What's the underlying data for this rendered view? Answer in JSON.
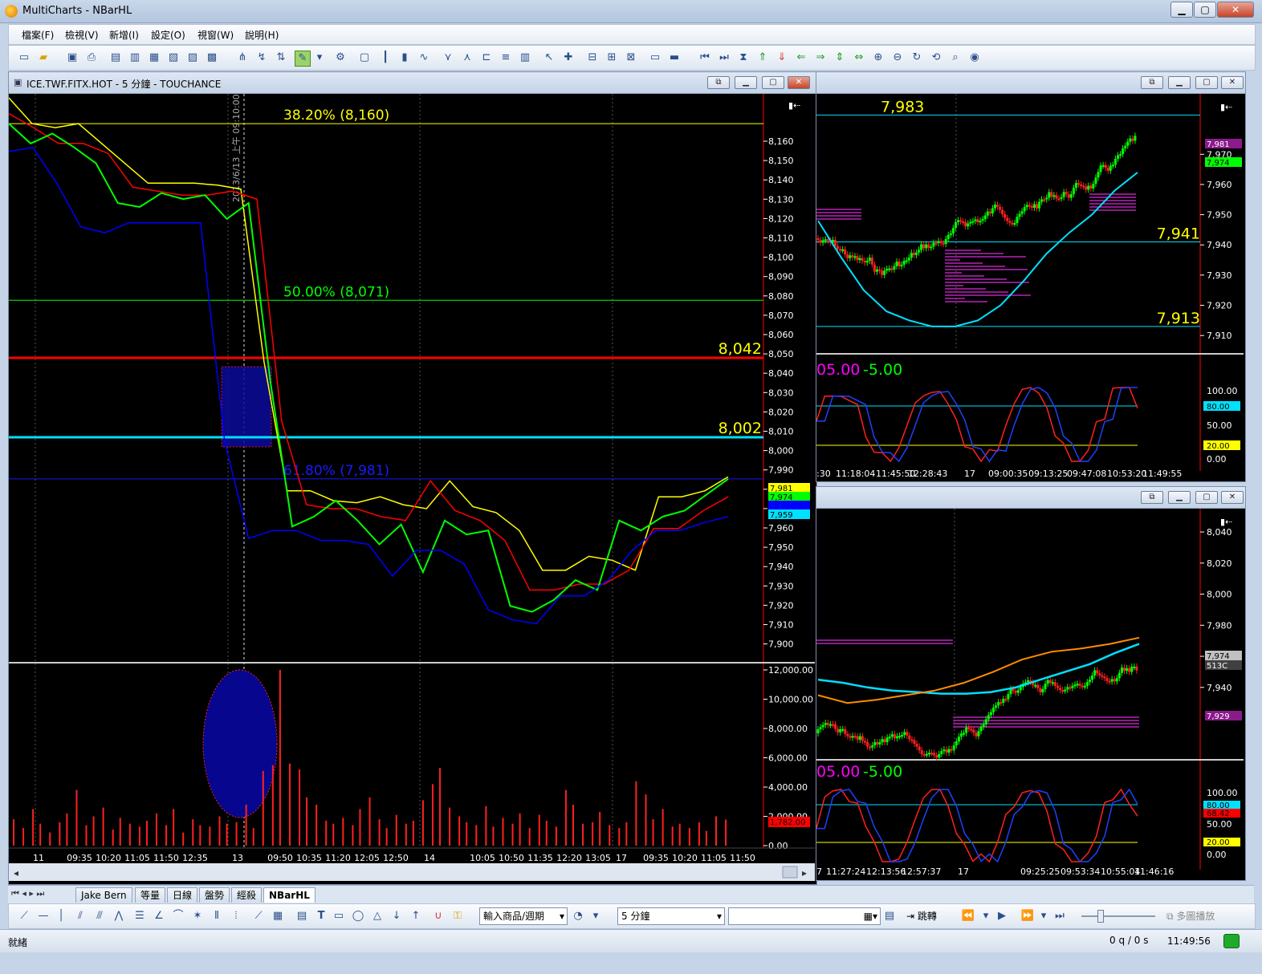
{
  "window": {
    "title": "MultiCharts - NBarHL",
    "min": "▁",
    "max": "▢",
    "close": "✕"
  },
  "menu": [
    "檔案(F)",
    "檢視(V)",
    "新增(I)",
    "設定(O)",
    "視窗(W)",
    "說明(H)"
  ],
  "colors": {
    "bg": "#000000",
    "red": "#ff0000",
    "cyan": "#00e0ff",
    "yellow": "#ffff00",
    "green": "#00ff00",
    "blue": "#0000ff",
    "magenta": "#ff00ff",
    "orange": "#ff8c00",
    "fib_blue": "#1a1aff"
  },
  "main_chart": {
    "title": "ICE.TWF.FITX.HOT - 5 分鐘 - TOUCHANCE",
    "fib_levels": [
      {
        "label": "38.20% (8,160)",
        "price": 8160,
        "color": "#ffff00"
      },
      {
        "label": "50.00% (8,071)",
        "price": 8071,
        "color": "#00ff00"
      },
      {
        "label": "61.80% (7,981)",
        "price": 7981,
        "color": "#1a1aff"
      }
    ],
    "hlines": [
      {
        "label": "8,042",
        "price": 8042,
        "color": "#ff0000"
      },
      {
        "label": "8,002",
        "price": 8002,
        "color": "#00e0ff"
      }
    ],
    "price_ticks": [
      "8,160",
      "8,150",
      "8,140",
      "8,130",
      "8,120",
      "8,110",
      "8,100",
      "8,090",
      "8,080",
      "8,070",
      "8,060",
      "8,050",
      "8,040",
      "8,030",
      "8,020",
      "8,010",
      "8,000",
      "7,990",
      "7,980",
      "7,970",
      "7,960",
      "7,950",
      "7,940",
      "7,930",
      "7,920",
      "7,910",
      "7,900"
    ],
    "price_tags": [
      {
        "text": "7,981",
        "bg": "#ffff00",
        "fg": "#000000"
      },
      {
        "text": "7,974",
        "bg": "#00ff00",
        "fg": "#000000"
      },
      {
        "text": "7,963",
        "bg": "#0000ff",
        "fg": "#0000ff"
      },
      {
        "text": "7,959",
        "bg": "#00e0ff",
        "fg": "#000000"
      }
    ],
    "cursor_date": "2013/6/13 上午 09:10:00",
    "volume_ticks": [
      "12,000.00",
      "10,000.00",
      "8,000.00",
      "6,000.00",
      "4,000.00",
      "2,000.00",
      "0.00"
    ],
    "volume_tag": "1,782.00",
    "x_labels": [
      "11",
      "09:35",
      "10:20",
      "11:05",
      "11:50",
      "12:35",
      "13",
      "09:50",
      "10:35",
      "11:20",
      "12:05",
      "12:50",
      "14",
      "10:05",
      "10:50",
      "11:35",
      "12:20",
      "13:05",
      "17",
      "09:35",
      "10:20",
      "11:05",
      "11:50"
    ]
  },
  "chart_data": [
    {
      "type": "line",
      "title": "ICE.TWF.FITX.HOT - 5 分鐘 - TOUCHANCE",
      "ylim": [
        7890,
        8175
      ],
      "series": [
        {
          "values": [
            8173,
            8160,
            8158,
            8160,
            8150,
            8140,
            8130,
            8130,
            8130,
            8129,
            8127,
            8040,
            7975,
            7975,
            7970,
            7969,
            7972,
            7968,
            7966,
            7980,
            7967,
            7964,
            7955,
            7935,
            7935,
            7942,
            7940,
            7935,
            7972,
            7972,
            7975,
            7982
          ]
        },
        {
          "values": [
            8165,
            8158,
            8150,
            8150,
            8145,
            8128,
            8126,
            8124,
            8124,
            8126,
            8122,
            8010,
            7968,
            7966,
            7966,
            7962,
            7960,
            7980,
            7965,
            7960,
            7950,
            7925,
            7925,
            7928,
            7928,
            7935,
            7956,
            7956,
            7965,
            7972
          ]
        },
        {
          "values": [
            8160,
            8150,
            8155,
            8148,
            8140,
            8120,
            8118,
            8125,
            8122,
            8124,
            8112,
            8120,
            8030,
            7957,
            7962,
            7970,
            7960,
            7948,
            7958,
            7934,
            7960,
            7953,
            7955,
            7917,
            7914,
            7920,
            7930,
            7925,
            7960,
            7955,
            7962,
            7965,
            7973,
            7981
          ]
        },
        {
          "values": [
            8146,
            8148,
            8130,
            8108,
            8105,
            8110,
            8110,
            8110,
            8110,
            8000,
            7951,
            7955,
            7955,
            7950,
            7950,
            7948,
            7932,
            7945,
            7945,
            7938,
            7915,
            7910,
            7908,
            7922,
            7922,
            7930,
            7945,
            7955,
            7955,
            7959,
            7962
          ]
        }
      ]
    },
    {
      "type": "bar",
      "title": "Volume",
      "ylim": [
        0,
        12000
      ],
      "values": [
        1800,
        1200,
        2500,
        1500,
        900,
        1600,
        2200,
        3800,
        1400,
        2000,
        2600,
        1100,
        1900,
        1500,
        1300,
        1700,
        2200,
        1400,
        2500,
        900,
        1800,
        1400,
        1300,
        2000,
        1500,
        1600,
        2800,
        1200,
        5100,
        5500,
        12000,
        5600,
        5200,
        3300,
        2800,
        1700,
        1500,
        1900,
        1400,
        2500,
        3300,
        1800,
        1200,
        2100,
        1500,
        1700,
        3100,
        4200,
        5300,
        2600,
        2000,
        1600,
        1400,
        2700,
        1300,
        1900,
        1500,
        2200,
        1200,
        2100,
        1700,
        1300,
        3800,
        2800,
        1500,
        1600,
        2300,
        1400,
        1200,
        1600,
        4400,
        3500,
        1800,
        2500,
        1300,
        1500,
        1200,
        1600,
        1000,
        2000,
        1782
      ]
    },
    {
      "type": "line",
      "title": "",
      "ylim": [
        7905,
        7990
      ],
      "series": [
        {
          "values": [
            7948,
            7936,
            7925,
            7918,
            7915,
            7913,
            7913,
            7915,
            7920,
            7928,
            7937,
            7944,
            7950,
            7958,
            7964
          ]
        }
      ]
    },
    {
      "type": "line",
      "title": "",
      "ylim": [
        7895,
        8055
      ],
      "series": [
        {
          "values": [
            7945,
            7943,
            7940,
            7938,
            7937,
            7936,
            7936,
            7937,
            7940,
            7945,
            7950,
            7955,
            7962,
            7968
          ]
        },
        {
          "values": [
            7935,
            7930,
            7932,
            7935,
            7938,
            7943,
            7950,
            7958,
            7963,
            7965,
            7968,
            7972
          ]
        }
      ]
    }
  ],
  "right_top": {
    "labels": [
      {
        "text": "7,983",
        "price": 7983
      },
      {
        "text": "7,941",
        "price": 7941
      },
      {
        "text": "7,913",
        "price": 7913
      }
    ],
    "ticks": [
      "7,970",
      "7,960",
      "7,950",
      "7,940",
      "7,930",
      "7,920",
      "7,910"
    ],
    "tags": [
      {
        "text": "7,981",
        "bg": "#8b1a8b",
        "fg": "#ffffff"
      },
      {
        "text": "7,974",
        "bg": "#00ff00",
        "fg": "#000000"
      }
    ],
    "osc_title": "05.00",
    "osc_value": "-5.00",
    "osc_ticks": [
      "100.00",
      "80.00",
      "50.00",
      "20.00",
      "0.00"
    ],
    "x_labels": [
      ":30",
      "11:18:04",
      "11:45:50",
      "12:28:43",
      "17",
      "09:00:35",
      "09:13:25",
      "09:47:08",
      "10:53:20",
      "11:49:55"
    ]
  },
  "right_bottom": {
    "ticks": [
      "8,040",
      "8,020",
      "8,000",
      "7,980",
      "7,960",
      "7,940"
    ],
    "tags": [
      {
        "text": "7,974",
        "bg": "#c0c0c0",
        "fg": "#000000"
      },
      {
        "text": "513C",
        "bg": "#404040",
        "fg": "#ffffff"
      },
      {
        "text": "7,929",
        "bg": "#8b1a8b",
        "fg": "#ffffff"
      }
    ],
    "osc_title": "05.00",
    "osc_value": "-5.00",
    "osc_ticks": [
      "100.00",
      "80.00",
      "50.00",
      "20.00",
      "0.00"
    ],
    "osc_tags": [
      {
        "text": "80.00",
        "bg": "#00e0ff"
      },
      {
        "text": "68.42",
        "bg": "#ff0000"
      },
      {
        "text": "20.00",
        "bg": "#ffff00"
      }
    ],
    "x_labels": [
      "7",
      "11:27:24",
      "12:13:56",
      "12:57:37",
      "17",
      "09:25:25",
      "09:53:34",
      "10:55:04",
      "11:46:16"
    ]
  },
  "tabs": [
    "Jake Bern",
    "等量",
    "日線",
    "盤勢",
    "經殺",
    "NBarHL"
  ],
  "active_tab": "NBarHL",
  "drawbar": {
    "symbol_input": "輸入商品/週期",
    "interval": "5 分鐘",
    "jump": "跳轉",
    "multi_play": "多圖播放"
  },
  "status": {
    "text": "就緒",
    "queue": "0 q / 0 s",
    "time": "11:49:56"
  }
}
